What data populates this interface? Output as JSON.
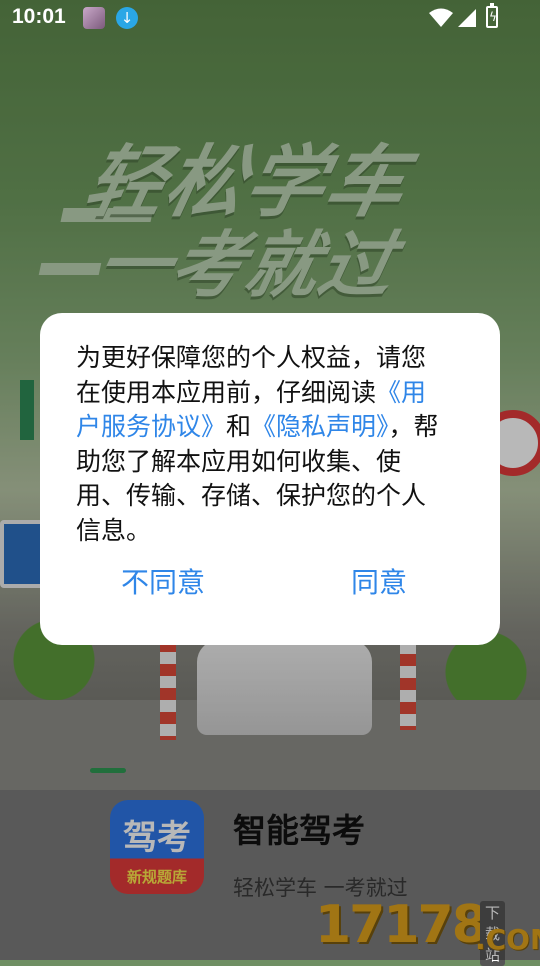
{
  "statusbar": {
    "time": "10:01",
    "icons": [
      "avatar-notification-icon",
      "download-icon",
      "wifi-icon",
      "signal-icon",
      "battery-charging-icon"
    ]
  },
  "hero": {
    "line1": "轻松学车",
    "line2": "一考就过"
  },
  "dialog": {
    "intro": "为更好保障您的个人权益，请您在使用本应用前，仔细阅读",
    "link_user_agreement": "《用户服务协议》",
    "and": "和",
    "link_privacy": "《隐私声明》",
    "outro": "，帮助您了解本应用如何收集、使用、传输、存储、保护您的个人信息。",
    "disagree_label": "不同意",
    "agree_label": "同意"
  },
  "app": {
    "icon_main": "驾考",
    "icon_sub": "新规题库",
    "name": "智能驾考",
    "slogan": "轻松学车 一考就过"
  },
  "watermark": {
    "number": "17178",
    "domain": ".COM",
    "tag": "下载站"
  },
  "colors": {
    "accent": "#2f86e8",
    "indicator": "#2f9a54",
    "icon_blue": "#2f77e8",
    "icon_red": "#e23b3b"
  }
}
